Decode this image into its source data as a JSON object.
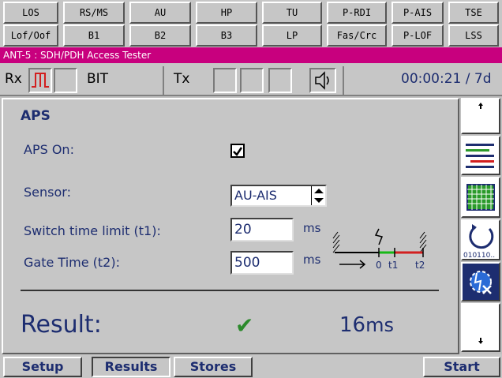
{
  "alarms": {
    "row1": [
      "LOS",
      "RS/MS",
      "AU",
      "HP",
      "TU",
      "P-RDI",
      "P-AIS",
      "TSE"
    ],
    "row2": [
      "Lof/Oof",
      "B1",
      "B2",
      "B3",
      "LP",
      "Fas/Crc",
      "P-LOF",
      "LSS"
    ]
  },
  "title": "ANT-5 : SDH/PDH Access Tester",
  "status": {
    "rx_label": "Rx",
    "bit_label": "BIT",
    "tx_label": "Tx",
    "elapsed": "00:00:21 / 7d"
  },
  "aps": {
    "heading": "APS",
    "aps_on_label": "APS On:",
    "aps_on_checked": true,
    "sensor_label": "Sensor:",
    "sensor_value": "AU-AIS",
    "t1_label": "Switch time limit (t1):",
    "t1_value": "20",
    "t1_unit": "ms",
    "t2_label": "Gate Time (t2):",
    "t2_value": "500",
    "t2_unit": "ms",
    "result_label": "Result:",
    "result_value": "16",
    "result_unit": "ms"
  },
  "diagram": {
    "zero": "0",
    "t1": "t1",
    "t2": "t2"
  },
  "icons": {
    "scroll_up": "scroll-up-icon",
    "list_view": "list-view-icon",
    "grid_view": "grid-view-icon",
    "counter": "counter-icon",
    "alarm_config": "alarm-config-icon",
    "scroll_down": "scroll-down-icon"
  },
  "counter_label": "010110..",
  "tabs": {
    "setup": "Setup",
    "results": "Results",
    "stores": "Stores",
    "start": "Start"
  }
}
